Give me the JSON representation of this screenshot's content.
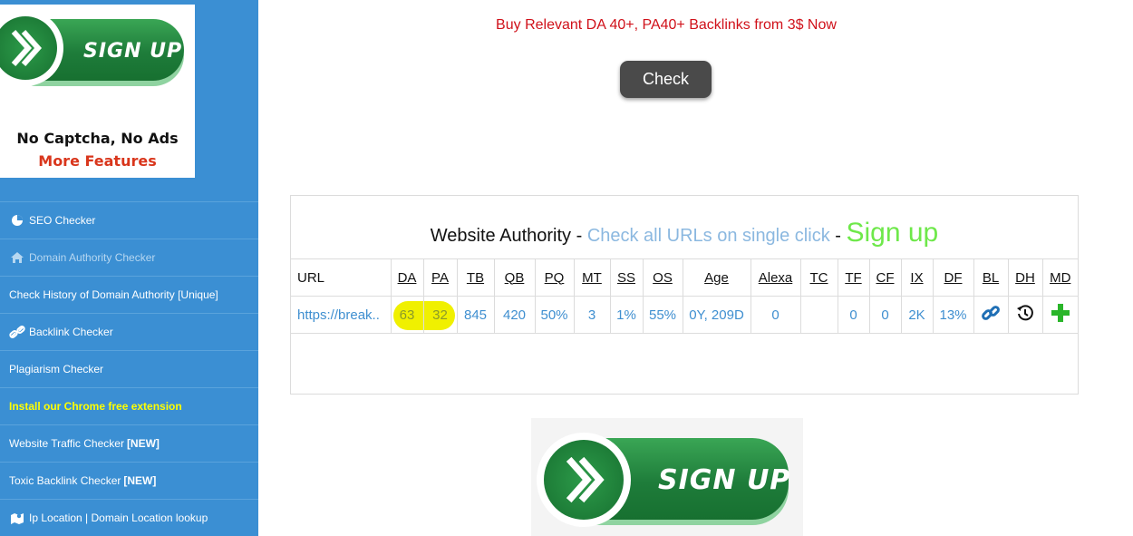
{
  "side_banner": {
    "button_text": "SIGN UP",
    "line1": "No Captcha, No Ads",
    "line2": "More Features"
  },
  "nav": {
    "items": [
      {
        "label": "SEO Checker",
        "icon": "pie-chart-icon",
        "style": "normal"
      },
      {
        "label": "Domain Authority Checker",
        "icon": "home-icon",
        "style": "muted"
      },
      {
        "label": "Check History of Domain Authority [Unique]",
        "icon": "",
        "style": "normal"
      },
      {
        "label": "Backlink Checker",
        "icon": "link-icon",
        "style": "normal"
      },
      {
        "label": "Plagiarism Checker",
        "icon": "",
        "style": "normal"
      },
      {
        "label": "Install our Chrome free extension",
        "icon": "",
        "style": "yellow"
      },
      {
        "label": "Website Traffic Checker",
        "tag": "[NEW]",
        "icon": "",
        "style": "normal"
      },
      {
        "label": "Toxic Backlink Checker",
        "tag": "[NEW]",
        "icon": "",
        "style": "normal"
      },
      {
        "label": "Ip Location | Domain Location lookup",
        "icon": "map-icon",
        "style": "normal"
      }
    ]
  },
  "promo_text": "Buy Relevant DA 40+, PA40+ Backlinks from 3$ Now",
  "check_button": "Check",
  "result": {
    "title": "Website Authority",
    "sep1": " - ",
    "subtitle": "Check all URLs on single click",
    "sep2": " - ",
    "signup": "Sign up",
    "columns": [
      "URL",
      "DA",
      "PA",
      "TB",
      "QB",
      "PQ",
      "MT",
      "SS",
      "OS",
      "Age",
      "Alexa",
      "TC",
      "TF",
      "CF",
      "IX",
      "DF",
      "BL",
      "DH",
      "MD"
    ],
    "row": {
      "url": "https://break..",
      "da": "63",
      "pa": "32",
      "tb": "845",
      "qb": "420",
      "pq": "50%",
      "mt": "3",
      "ss": "1%",
      "os": "55%",
      "age": "0Y, 209D",
      "alexa": "0",
      "tc": "",
      "tf": "0",
      "cf": "0",
      "ix": "2K",
      "df": "13%"
    },
    "highlight_color": "#f0f000"
  },
  "bottom_banner": {
    "button_text": "SIGN UP"
  },
  "colors": {
    "sidebar": "#3b8fd3",
    "promo": "#d0111a",
    "link": "#3f8fd0",
    "signup": "#6ee84a"
  }
}
